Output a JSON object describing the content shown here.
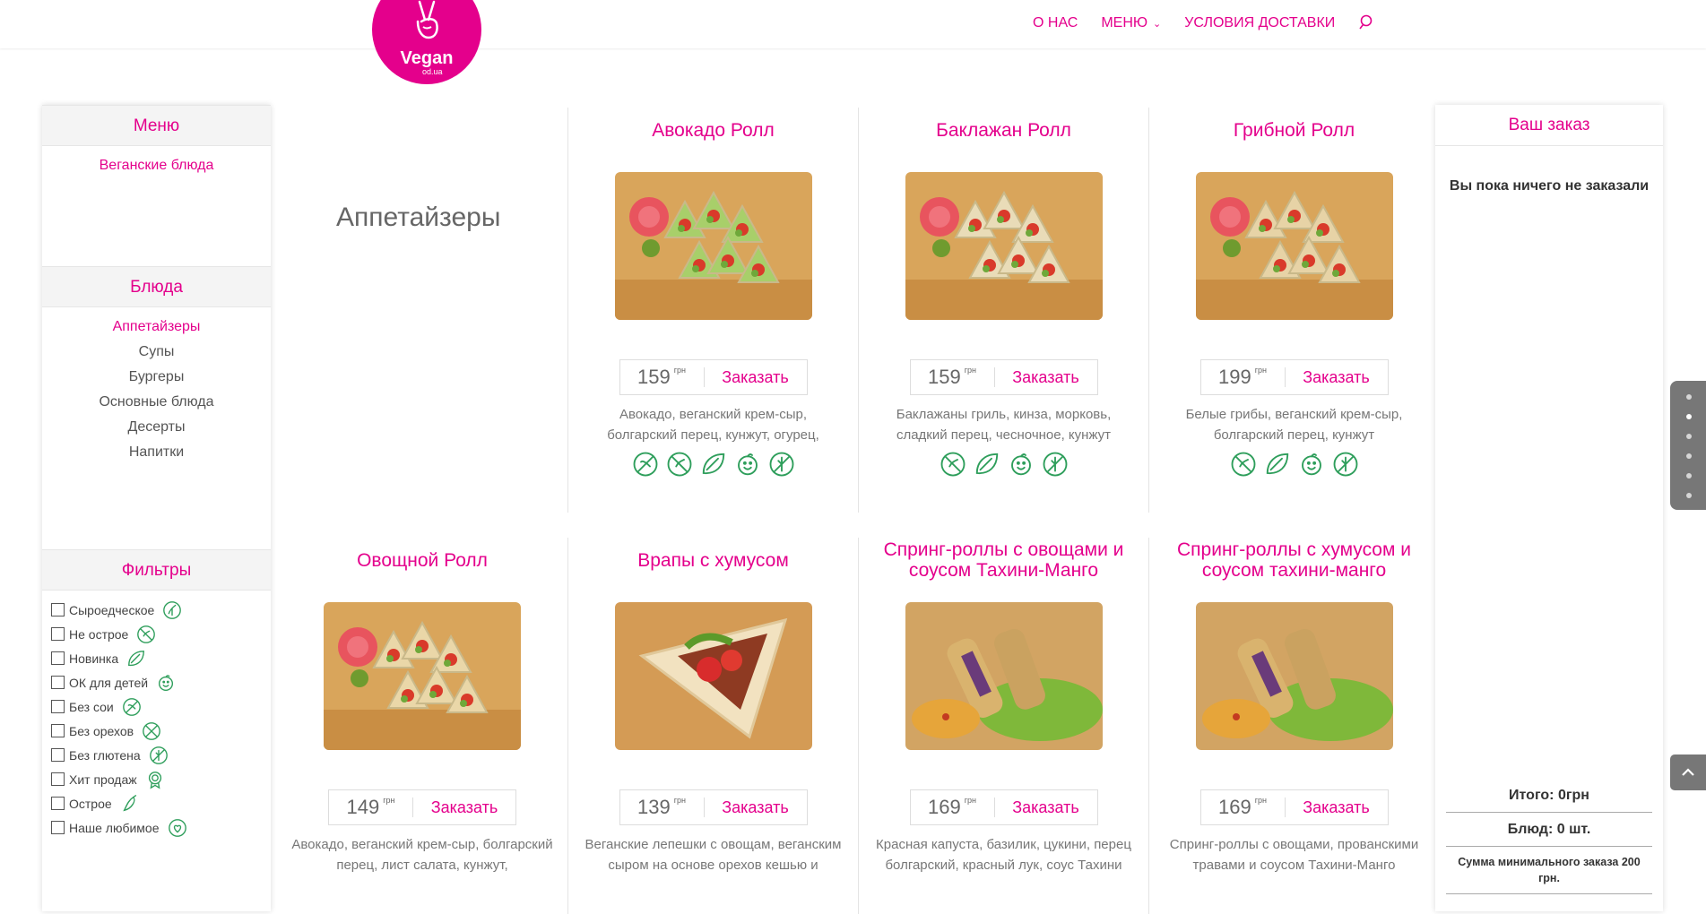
{
  "brand": {
    "name": "Vegan",
    "sub": "od.ua",
    "color": "#e4008c"
  },
  "nav": {
    "about": "О НАС",
    "menu": "МЕНЮ",
    "delivery": "УСЛОВИЯ ДОСТАВКИ"
  },
  "sidebar": {
    "menu_title": "Меню",
    "menu_items": [
      "Веганские блюда"
    ],
    "dishes_title": "Блюда",
    "dishes": [
      "Аппетайзеры",
      "Супы",
      "Бургеры",
      "Основные блюда",
      "Десерты",
      "Напитки"
    ],
    "active_dish": "Аппетайзеры",
    "filters_title": "Фильтры",
    "filters": [
      {
        "label": "Сыроедческое",
        "icon": "raw-food-icon"
      },
      {
        "label": "Не острое",
        "icon": "not-spicy-icon"
      },
      {
        "label": "Новинка",
        "icon": "new-leaf-icon"
      },
      {
        "label": "ОК для детей",
        "icon": "kids-ok-icon"
      },
      {
        "label": "Без сои",
        "icon": "no-soy-icon"
      },
      {
        "label": "Без орехов",
        "icon": "no-nuts-icon"
      },
      {
        "label": "Без глютена",
        "icon": "no-gluten-icon"
      },
      {
        "label": "Хит продаж",
        "icon": "bestseller-icon"
      },
      {
        "label": "Острое",
        "icon": "spicy-icon"
      },
      {
        "label": "Наше любимое",
        "icon": "favorite-icon"
      }
    ]
  },
  "section_title": "Аппетайзеры",
  "currency": "грн",
  "order_label": "Заказать",
  "products": [
    {
      "name": "Авокадо Ролл",
      "price": "159",
      "desc": "Авокадо, веганский крем-сыр, болгарский перец, кунжут, огурец,",
      "icons": [
        "no-soy-icon",
        "not-spicy-icon",
        "new-leaf-icon",
        "kids-ok-icon",
        "no-gluten-icon"
      ]
    },
    {
      "name": "Баклажан Ролл",
      "price": "159",
      "desc": "Баклажаны гриль, кинза, морковь, сладкий перец, чесночное, кунжут",
      "icons": [
        "not-spicy-icon",
        "new-leaf-icon",
        "kids-ok-icon",
        "no-gluten-icon"
      ]
    },
    {
      "name": "Грибной Ролл",
      "price": "199",
      "desc": "Белые грибы, веганский крем-сыр, болгарский перец, кунжут",
      "icons": [
        "not-spicy-icon",
        "new-leaf-icon",
        "kids-ok-icon",
        "no-gluten-icon"
      ]
    },
    {
      "name": "Овощной Ролл",
      "price": "149",
      "desc": "Авокадо, веганский крем-сыр, болгарский перец, лист салата, кунжут,",
      "icons": []
    },
    {
      "name": "Врапы с хумусом",
      "price": "139",
      "desc": "Веганские лепешки с овощам, веганским сыром на основе орехов кешью и хумусом",
      "icons": []
    },
    {
      "name": "Спринг-роллы с овощами и соусом Тахини-Манго",
      "price": "169",
      "desc": "Красная капуста, базилик, цукини, перец болгарский, красный лук, соус Тахини Манго.",
      "icons": []
    },
    {
      "name": "Спринг-роллы с хумусом и соусом тахини-манго",
      "price": "169",
      "desc": "Спринг-роллы с овощами, прованскими травами и соусом Тахини-Манго",
      "icons": []
    }
  ],
  "order": {
    "title": "Ваш заказ",
    "empty": "Вы пока ничего не заказали",
    "total": "Итого:  0грн",
    "count": "Блюд:  0 шт.",
    "min_note": "Сумма минимального заказа 200 грн."
  },
  "dotnav_active": 1
}
